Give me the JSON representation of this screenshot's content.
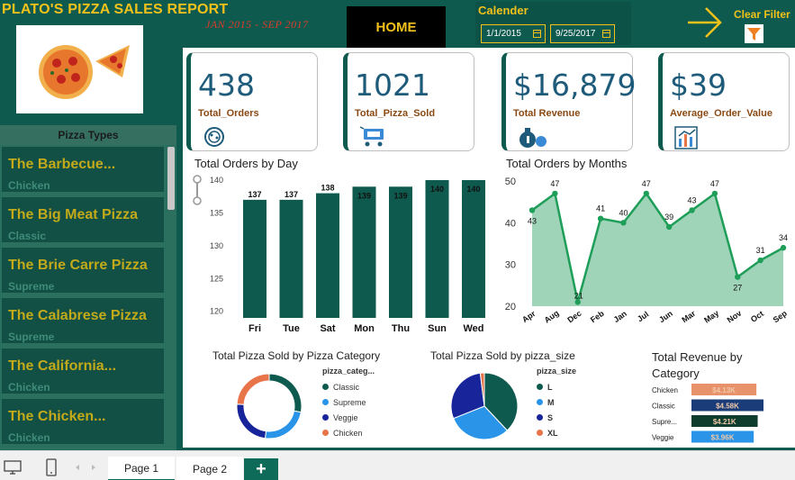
{
  "header": {
    "title": "PLATO'S PIZZA SALES  REPORT",
    "date_range": "JAN 2015  -  SEP 2017",
    "home_label": "HOME",
    "calendar_label": "Calender",
    "start_date": "1/1/2015",
    "end_date": "9/25/2017",
    "clear_filter_label": "Clear Filter"
  },
  "slicer": {
    "title": "Pizza Types",
    "items": [
      {
        "name": "The Barbecue...",
        "category": "Chicken"
      },
      {
        "name": "The Big Meat Pizza",
        "category": "Classic"
      },
      {
        "name": "The Brie Carre Pizza",
        "category": "Supreme"
      },
      {
        "name": "The Calabrese Pizza",
        "category": "Supreme"
      },
      {
        "name": "The California...",
        "category": "Chicken"
      },
      {
        "name": "The Chicken...",
        "category": "Chicken"
      }
    ]
  },
  "kpis": [
    {
      "value": "438",
      "label": "Total_Orders",
      "icon": "pizza-icon"
    },
    {
      "value": "1021",
      "label": "Total_Pizza_Sold",
      "icon": "sale-cart-icon"
    },
    {
      "value": "$16,879",
      "label": "Total Revenue",
      "icon": "money-bag-icon"
    },
    {
      "value": "$39",
      "label": "Average_Order_Value",
      "icon": "bar-chart-icon"
    }
  ],
  "chart_data": [
    {
      "type": "bar",
      "title": "Total Orders by Day",
      "categories": [
        "Fri",
        "Tue",
        "Sat",
        "Mon",
        "Thu",
        "Sun",
        "Wed"
      ],
      "values": [
        137,
        137,
        138,
        139,
        139,
        140,
        140
      ],
      "yticks": [
        120,
        125,
        130,
        135,
        140
      ],
      "ylim": [
        119,
        140
      ],
      "color": "#0e5a4e"
    },
    {
      "type": "area",
      "title": "Total Orders by Months",
      "categories": [
        "Apr",
        "Aug",
        "Dec",
        "Feb",
        "Jan",
        "Jul",
        "Jun",
        "Mar",
        "May",
        "Nov",
        "Oct",
        "Sep"
      ],
      "values": [
        43,
        47,
        21,
        41,
        40,
        47,
        39,
        43,
        47,
        27,
        31,
        34
      ],
      "yticks": [
        20,
        30,
        40,
        50
      ],
      "ylim": [
        20,
        50
      ],
      "line_color": "#1e9e58",
      "fill_color": "#9fd4b9"
    },
    {
      "type": "pie",
      "title": "Total Pizza Sold by Pizza Category",
      "donut": true,
      "legend_title": "pizza_categ...",
      "labels": [
        "Classic",
        "Supreme",
        "Veggie",
        "Chicken"
      ],
      "values": [
        28,
        24,
        24,
        24
      ],
      "colors": [
        "#0e5a4e",
        "#2a95e8",
        "#17249a",
        "#e8744a"
      ]
    },
    {
      "type": "pie",
      "title": "Total Pizza Sold by pizza_size",
      "donut": false,
      "legend_title": "pizza_size",
      "labels": [
        "L",
        "M",
        "S",
        "XL"
      ],
      "values": [
        38,
        31,
        29,
        2
      ],
      "colors": [
        "#0e5a4e",
        "#2a95e8",
        "#17249a",
        "#e8744a"
      ]
    },
    {
      "type": "bar",
      "orientation": "horizontal",
      "title": "Total Revenue by Category",
      "categories": [
        "Chicken",
        "Classic",
        "Supre...",
        "Veggie"
      ],
      "values": [
        4.13,
        4.58,
        4.21,
        3.96
      ],
      "data_labels": [
        "$4.13K",
        "$4.58K",
        "$4.21K",
        "$3.96K"
      ],
      "colors": [
        "#e8926b",
        "#1a3d7a",
        "#0e3d2e",
        "#2a95e8"
      ]
    }
  ],
  "pages": {
    "tabs": [
      "Page 1",
      "Page 2"
    ],
    "add_label": "+"
  }
}
